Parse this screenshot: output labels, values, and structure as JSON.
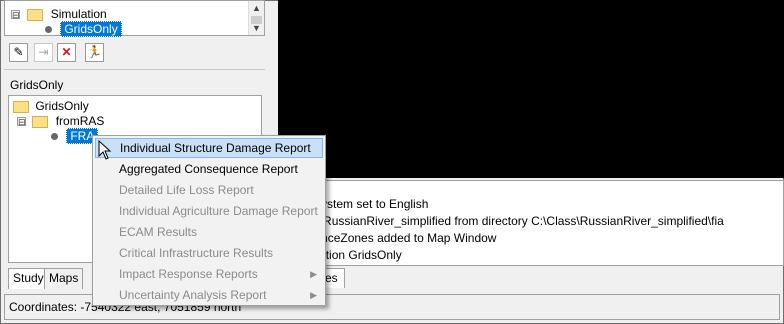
{
  "left_panel": {
    "top_tree": [
      {
        "label": "Simulation",
        "expander": "⊟"
      },
      {
        "label": "GridsOnly",
        "selected": true
      }
    ],
    "toolbar": {
      "edit_icon": "pencil-icon",
      "import_icon": "import-icon",
      "delete_icon": "delete-x-icon",
      "run_icon": "run-icon"
    },
    "section_label": "GridsOnly",
    "tree": {
      "root": "GridsOnly",
      "child": "fromRAS",
      "child_expander": "⊟",
      "leaf": "FRA"
    },
    "tabs": [
      "Study",
      "Maps"
    ]
  },
  "log": {
    "lines": [
      "y Unit System set to English",
      "d Study RussianRiver_simplified from directory C:\\Class\\RussianRiver_simplified\\fia",
      "ngIssuanceZones added to Map Window",
      "g Simulation GridsOnly"
    ],
    "tab_fragment": "es"
  },
  "context_menu": {
    "items": [
      {
        "label": "Individual Structure Damage Report",
        "enabled": true,
        "hover": true,
        "submenu": false
      },
      {
        "label": "Aggregated Consequence Report",
        "enabled": true,
        "hover": false,
        "submenu": false
      },
      {
        "label": "Detailed Life Loss Report",
        "enabled": false,
        "hover": false,
        "submenu": false
      },
      {
        "label": "Individual Agriculture Damage Report",
        "enabled": false,
        "hover": false,
        "submenu": false
      },
      {
        "label": "ECAM Results",
        "enabled": false,
        "hover": false,
        "submenu": false
      },
      {
        "label": "Critical Infrastructure Results",
        "enabled": false,
        "hover": false,
        "submenu": false
      },
      {
        "label": "Impact Response Reports",
        "enabled": false,
        "hover": false,
        "submenu": true
      },
      {
        "label": "Uncertainty Analysis Report",
        "enabled": false,
        "hover": false,
        "submenu": true
      }
    ]
  },
  "status_bar": {
    "coordinates": "Coordinates: -7540322 east, 7051859 north"
  },
  "colors": {
    "selection": "#0078d7",
    "menu_hover": "#c9e0f7",
    "disabled_text": "#8b8b8b",
    "folder": "#fbe08a"
  }
}
